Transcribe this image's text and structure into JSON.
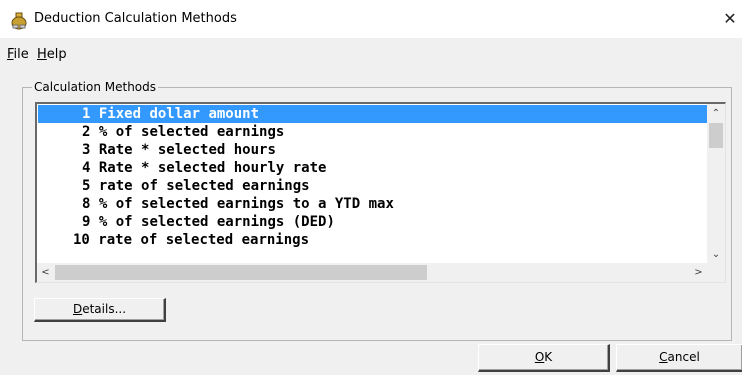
{
  "window": {
    "title": "Deduction Calculation Methods",
    "close_glyph": "✕"
  },
  "menu": {
    "file": {
      "mnemonic": "F",
      "rest": "ile"
    },
    "help": {
      "mnemonic": "H",
      "rest": "elp"
    }
  },
  "group": {
    "label": "Calculation Methods"
  },
  "methods": [
    {
      "id": "1",
      "label": "Fixed dollar amount",
      "selected": true
    },
    {
      "id": "2",
      "label": "% of selected earnings",
      "selected": false
    },
    {
      "id": "3",
      "label": "Rate * selected hours",
      "selected": false
    },
    {
      "id": "4",
      "label": "Rate * selected hourly rate",
      "selected": false
    },
    {
      "id": "5",
      "label": "rate of selected earnings",
      "selected": false
    },
    {
      "id": "8",
      "label": "% of selected earnings to a YTD max",
      "selected": false
    },
    {
      "id": "9",
      "label": "% of selected earnings (DED)",
      "selected": false
    },
    {
      "id": "10",
      "label": "rate of selected earnings",
      "selected": false
    }
  ],
  "scrollbars": {
    "up_arrow": "⌃",
    "down_arrow": "⌄",
    "left_arrow": "<",
    "right_arrow": ">"
  },
  "buttons": {
    "details": {
      "mnemonic": "D",
      "rest": "etails..."
    },
    "ok": {
      "mnemonic": "O",
      "rest": "K"
    },
    "cancel": {
      "mnemonic": "C",
      "rest": "ancel"
    }
  },
  "colors": {
    "selection": "#3399ff",
    "dialog_bg": "#f0f0f0"
  }
}
